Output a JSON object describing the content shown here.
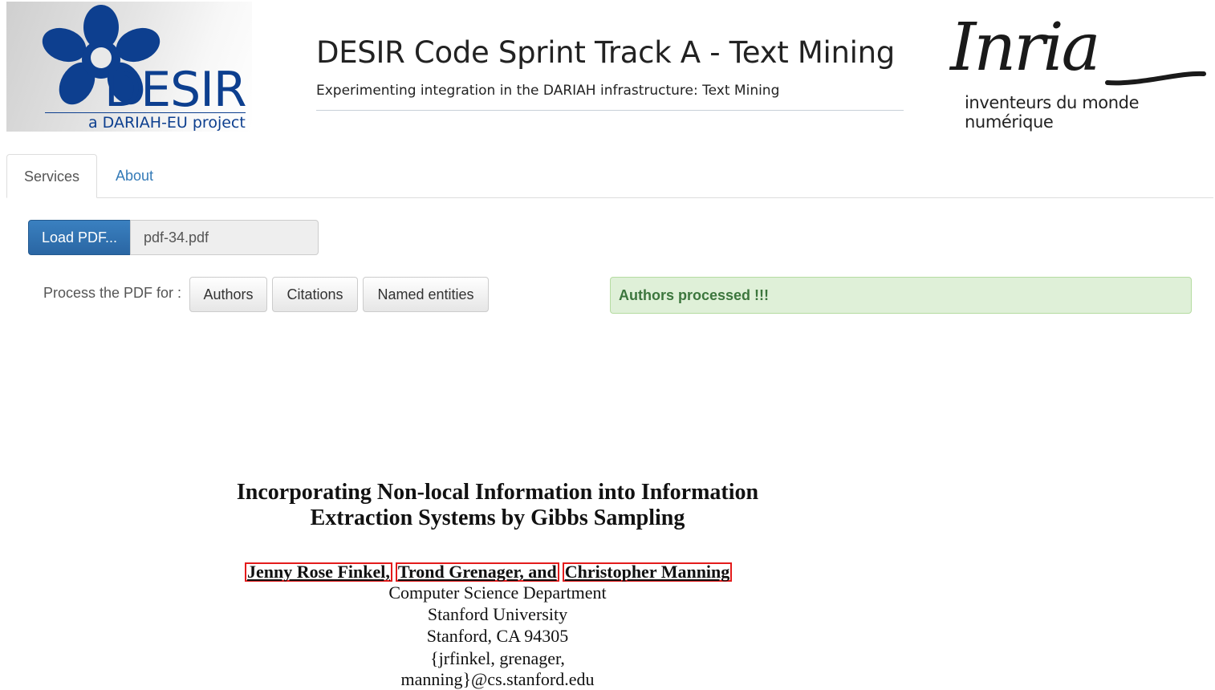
{
  "header": {
    "desir_logo": {
      "wordmark": "DESIR",
      "tagline": "a DARIAH-EU project"
    },
    "title": "DESIR Code Sprint Track A - Text Mining",
    "subtitle": "Experimenting integration in the DARIAH infrastructure: Text Mining",
    "inria_logo": {
      "wordmark": "Inria",
      "tagline": "inventeurs du monde numérique"
    }
  },
  "tabs": [
    {
      "label": "Services",
      "active": true
    },
    {
      "label": "About",
      "active": false
    }
  ],
  "load": {
    "button_label": "Load PDF...",
    "file_name": "pdf-34.pdf"
  },
  "process": {
    "label": "Process the PDF for :",
    "buttons": [
      "Authors",
      "Citations",
      "Named entities"
    ],
    "status": "Authors processed !!!"
  },
  "paper": {
    "title_line1": "Incorporating Non-local Information into Information",
    "title_line2": "Extraction Systems by Gibbs Sampling",
    "authors": [
      "Jenny Rose Finkel,",
      "Trond Grenager, and",
      "Christopher Manning"
    ],
    "affiliation": [
      "Computer Science Department",
      "Stanford University",
      "Stanford, CA 94305",
      "{jrfinkel, grenager, manning}@cs.stanford.edu"
    ]
  },
  "colors": {
    "desir_blue": "#0d3f8f",
    "primary_button": "#2a66a3",
    "link": "#337ab7",
    "success_bg": "#dff0d8",
    "success_text": "#3c763d",
    "author_highlight": "#e31b1b"
  }
}
